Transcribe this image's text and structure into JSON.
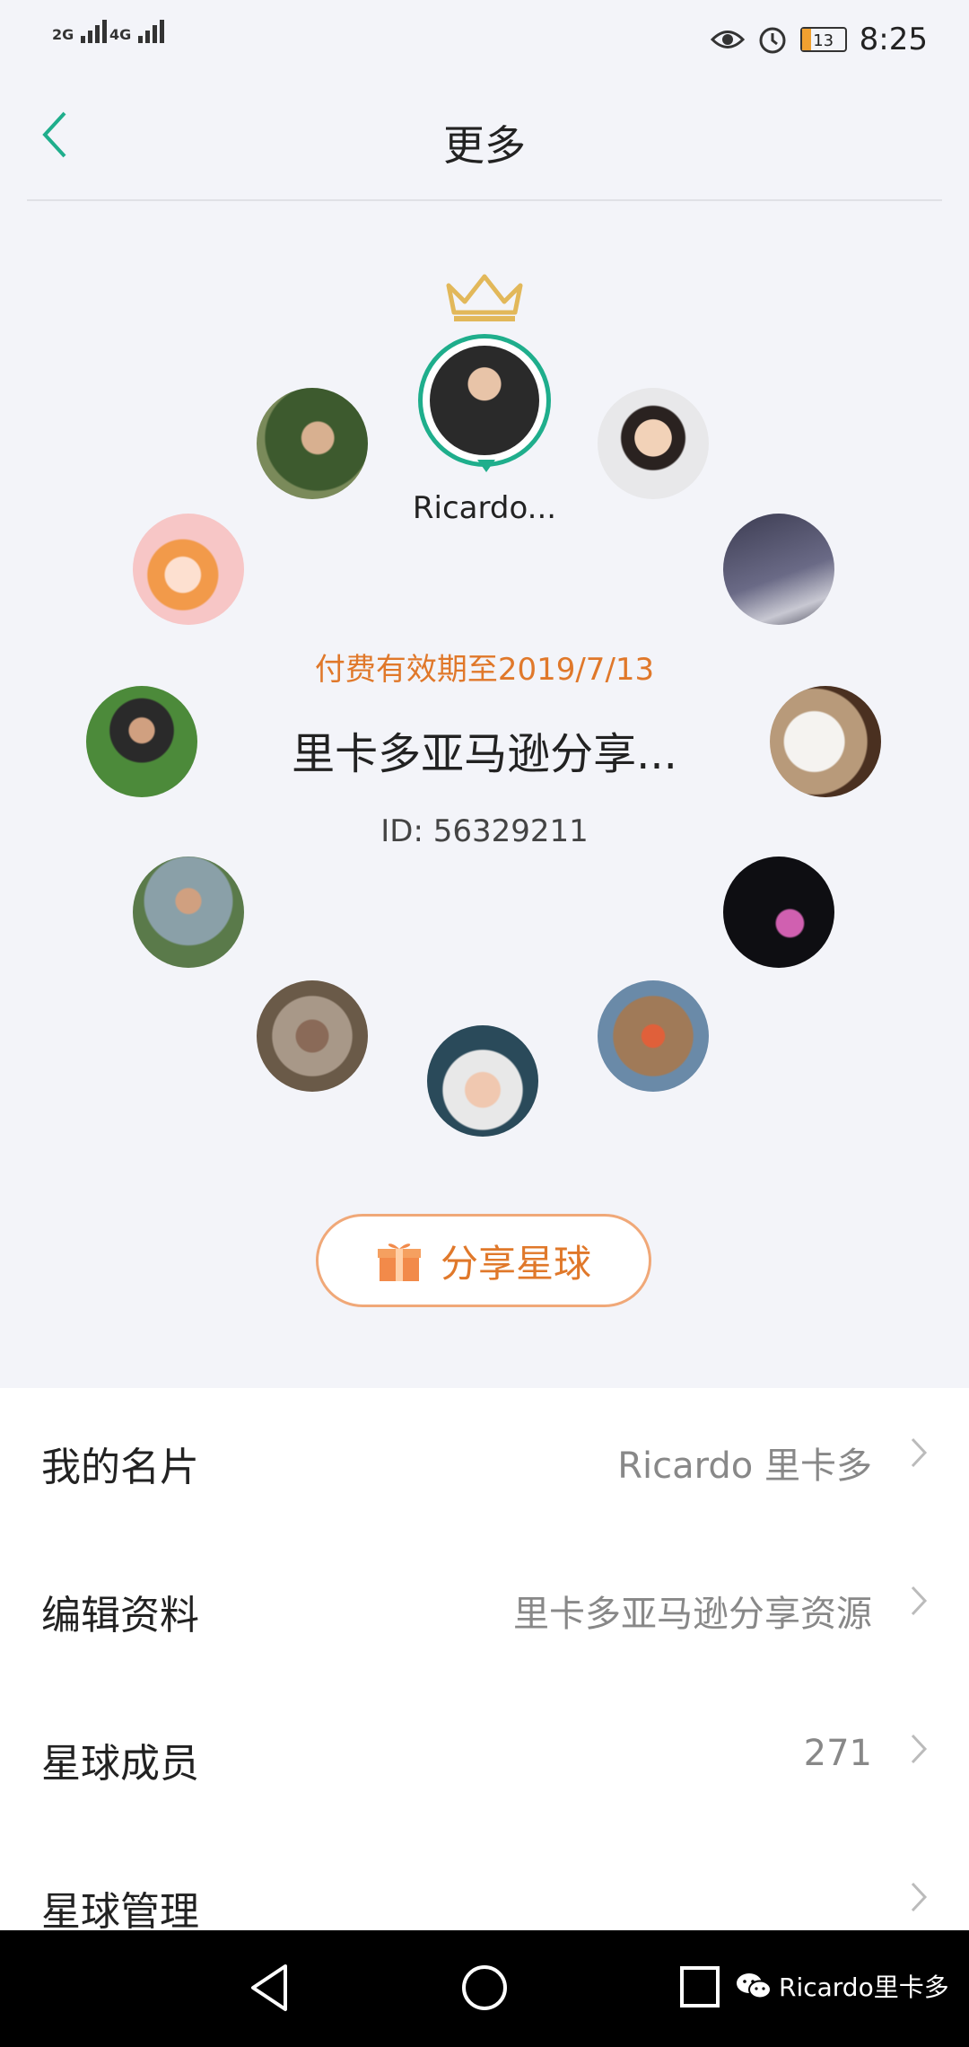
{
  "status_bar": {
    "signal1": "2G",
    "signal2": "4G",
    "battery": "13",
    "time": "8:25"
  },
  "nav": {
    "title": "更多"
  },
  "owner": {
    "name": "Ricardo..."
  },
  "planet": {
    "valid_until": "付费有效期至2019/7/13",
    "name": "里卡多亚马逊分享...",
    "id_text": "ID: 56329211"
  },
  "share_button": {
    "label": "分享星球"
  },
  "menu": [
    {
      "label": "我的名片",
      "value": "Ricardo 里卡多"
    },
    {
      "label": "编辑资料",
      "value": "里卡多亚马逊分享资源"
    },
    {
      "label": "星球成员",
      "value": "271"
    },
    {
      "label": "星球管理",
      "value": ""
    }
  ],
  "watermark": {
    "text": "Ricardo里卡多"
  }
}
